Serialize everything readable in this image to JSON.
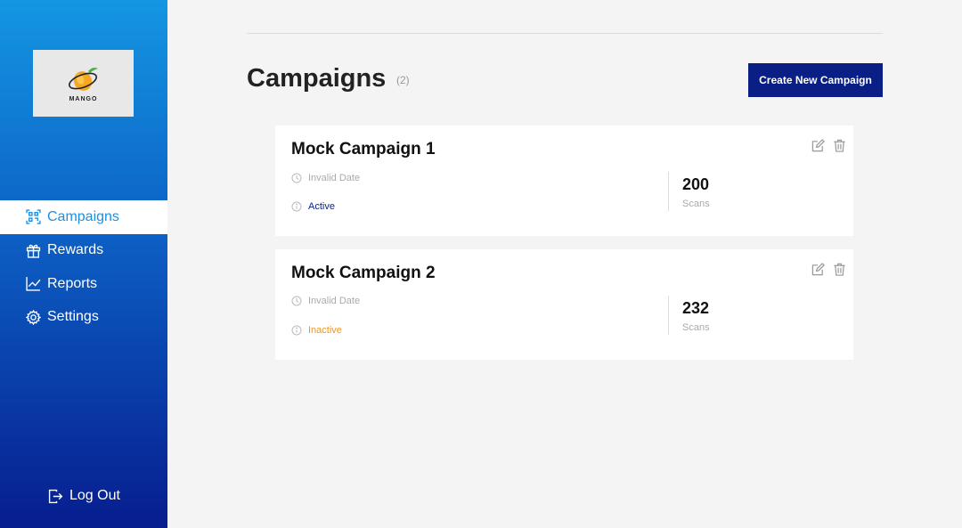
{
  "brand": {
    "logo_text": "MANGO"
  },
  "sidebar": {
    "items": [
      {
        "label": "Campaigns",
        "icon": "qr-code-icon",
        "active": true
      },
      {
        "label": "Rewards",
        "icon": "gift-icon",
        "active": false
      },
      {
        "label": "Reports",
        "icon": "line-chart-icon",
        "active": false
      },
      {
        "label": "Settings",
        "icon": "gear-icon",
        "active": false
      }
    ],
    "logout_label": "Log Out"
  },
  "header": {
    "title": "Campaigns",
    "count": "(2)",
    "create_label": "Create New Campaign"
  },
  "campaigns": [
    {
      "name": "Mock Campaign 1",
      "date": "Invalid Date",
      "status": "Active",
      "scans": "200",
      "scans_label": "Scans"
    },
    {
      "name": "Mock Campaign 2",
      "date": "Invalid Date",
      "status": "Inactive",
      "scans": "232",
      "scans_label": "Scans"
    }
  ],
  "colors": {
    "sidebar_top": "#1496e2",
    "sidebar_bottom": "#071d8e",
    "accent": "#0a1f85",
    "active_nav_text": "#1f8fe0",
    "inactive_status": "#f0941e"
  }
}
